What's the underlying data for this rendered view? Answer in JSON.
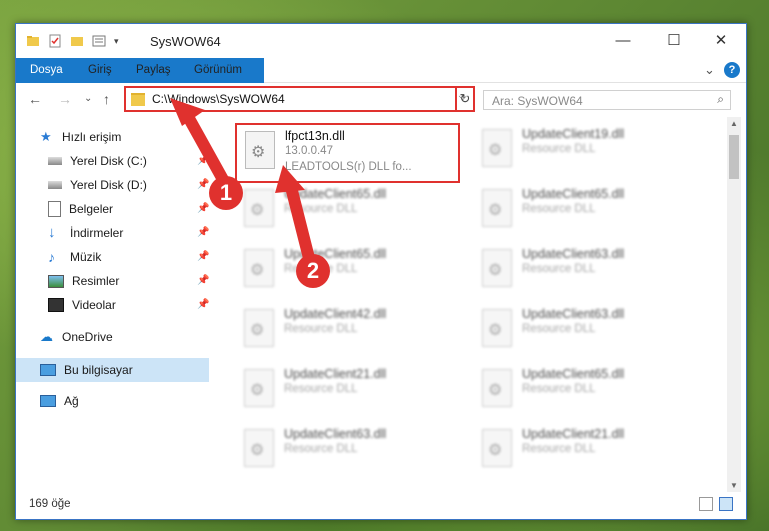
{
  "window": {
    "title": "SysWOW64",
    "controls": {
      "minimize": "—",
      "maximize": "☐",
      "close": "✕"
    }
  },
  "ribbon": {
    "tabs": [
      "Dosya",
      "Giriş",
      "Paylaş",
      "Görünüm"
    ],
    "expand_icon": "⌄",
    "help_icon": "?"
  },
  "address_bar": {
    "path": "C:\\Windows\\SysWOW64",
    "dropdown": "⌵",
    "refresh": "↻"
  },
  "search": {
    "placeholder": "Ara: SysWOW64",
    "icon": "⌕"
  },
  "nav_buttons": {
    "back": "←",
    "forward": "→",
    "recent": "⌄",
    "up": "↑"
  },
  "sidebar": {
    "quick_access": "Hızlı erişim",
    "items": [
      {
        "label": "Yerel Disk (C:)",
        "icon": "drive-icon",
        "pinned": true
      },
      {
        "label": "Yerel Disk (D:)",
        "icon": "drive-icon",
        "pinned": true
      },
      {
        "label": "Belgeler",
        "icon": "documents-icon",
        "pinned": true
      },
      {
        "label": "İndirmeler",
        "icon": "download-icon",
        "pinned": true
      },
      {
        "label": "Müzik",
        "icon": "music-icon",
        "pinned": true
      },
      {
        "label": "Resimler",
        "icon": "pictures-icon",
        "pinned": true
      },
      {
        "label": "Videolar",
        "icon": "videos-icon",
        "pinned": true
      }
    ],
    "onedrive": "OneDrive",
    "this_pc": "Bu bilgisayar",
    "network": "Ağ"
  },
  "files": {
    "selected": {
      "name": "lfpct13n.dll",
      "version": "13.0.0.47",
      "description": "LEADTOOLS(r) DLL fo..."
    },
    "blurred": [
      {
        "name": "UpdateClient19.dll",
        "type": "Resource DLL"
      },
      {
        "name": "UpdateClient65.dll",
        "type": "Resource DLL"
      },
      {
        "name": "UpdateClient65.dll",
        "type": "Resource DLL"
      },
      {
        "name": "UpdateClient65.dll",
        "type": "Resource DLL"
      },
      {
        "name": "UpdateClient63.dll",
        "type": "Resource DLL"
      },
      {
        "name": "UpdateClient42.dll",
        "type": "Resource DLL"
      },
      {
        "name": "UpdateClient63.dll",
        "type": "Resource DLL"
      },
      {
        "name": "UpdateClient21.dll",
        "type": "Resource DLL"
      },
      {
        "name": "UpdateClient65.dll",
        "type": "Resource DLL"
      },
      {
        "name": "UpdateClient63.dll",
        "type": "Resource DLL"
      },
      {
        "name": "UpdateClient21.dll",
        "type": "Resource DLL"
      }
    ]
  },
  "status": {
    "item_count": "169 öğe"
  },
  "callouts": [
    "1",
    "2"
  ],
  "colors": {
    "accent": "#1979ca",
    "highlight": "#e0312e",
    "selection": "#cce4f7"
  }
}
